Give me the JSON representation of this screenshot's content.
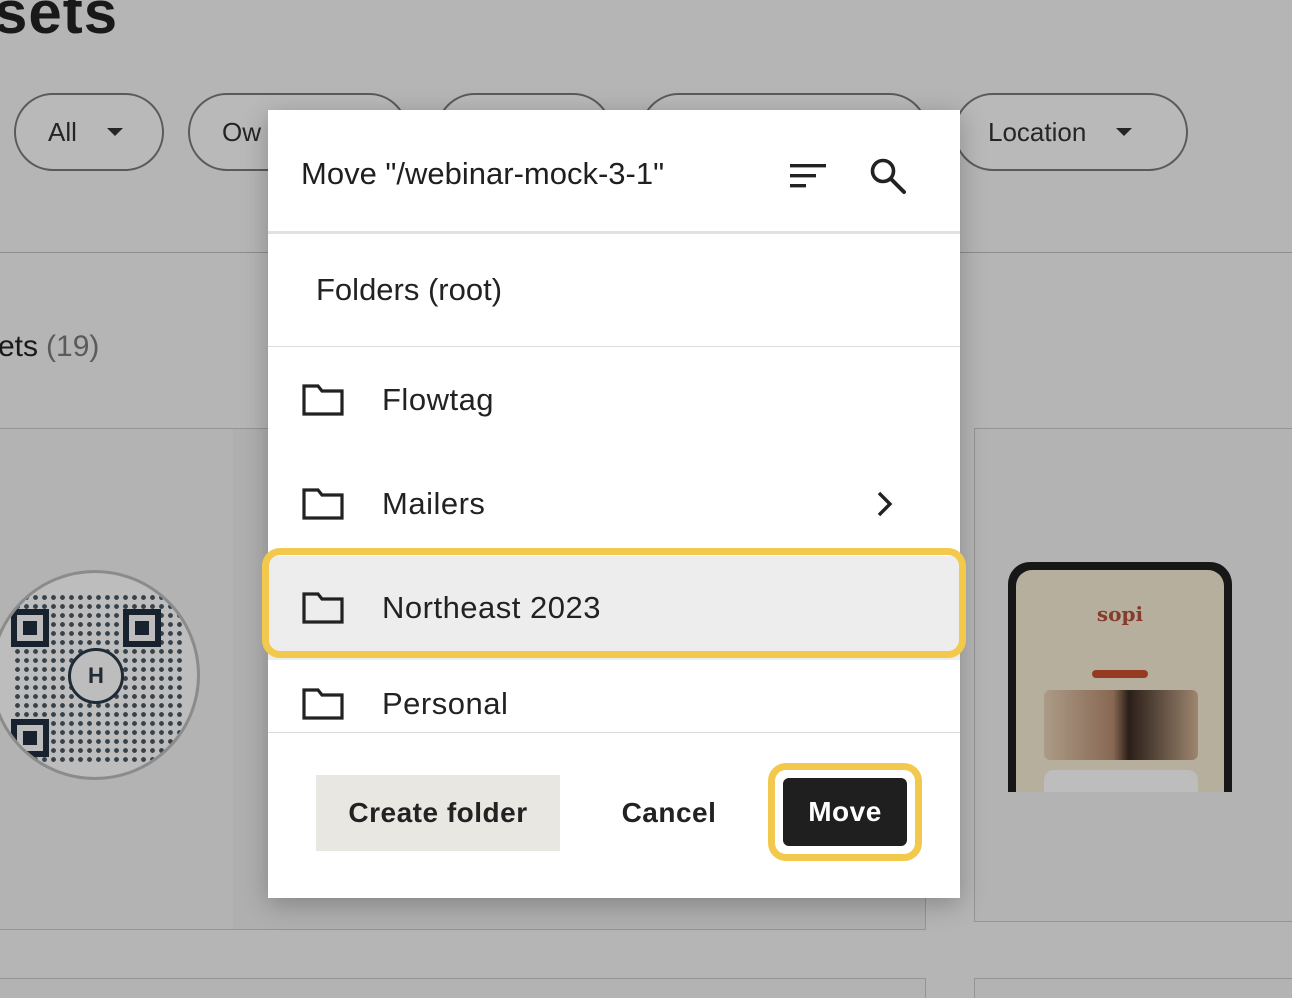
{
  "background": {
    "page_title": "sets",
    "filters": [
      {
        "label": "All"
      },
      {
        "label": "Ow"
      },
      {
        "label": ""
      },
      {
        "label": ""
      },
      {
        "label": "Location"
      }
    ],
    "assets_label": "ets",
    "assets_count": "(19)",
    "qr_center_letter": "H",
    "phone_brand": "sopi"
  },
  "modal": {
    "title": "Move \"/webinar-mock-3-1\"",
    "sort_icon": "sort-icon",
    "search_icon": "search-icon",
    "root_label": "Folders (root)",
    "folders": [
      {
        "name": "Flowtag",
        "has_children": false,
        "selected": false
      },
      {
        "name": "Mailers",
        "has_children": true,
        "selected": false
      },
      {
        "name": "Northeast 2023",
        "has_children": false,
        "selected": true
      },
      {
        "name": "Personal",
        "has_children": false,
        "selected": false
      }
    ],
    "buttons": {
      "create_folder": "Create folder",
      "cancel": "Cancel",
      "move": "Move"
    }
  },
  "colors": {
    "highlight": "#f2c94c",
    "primary_button": "#1f1f1f",
    "secondary_button": "#e9e7e1",
    "selected_row": "#ededed"
  }
}
